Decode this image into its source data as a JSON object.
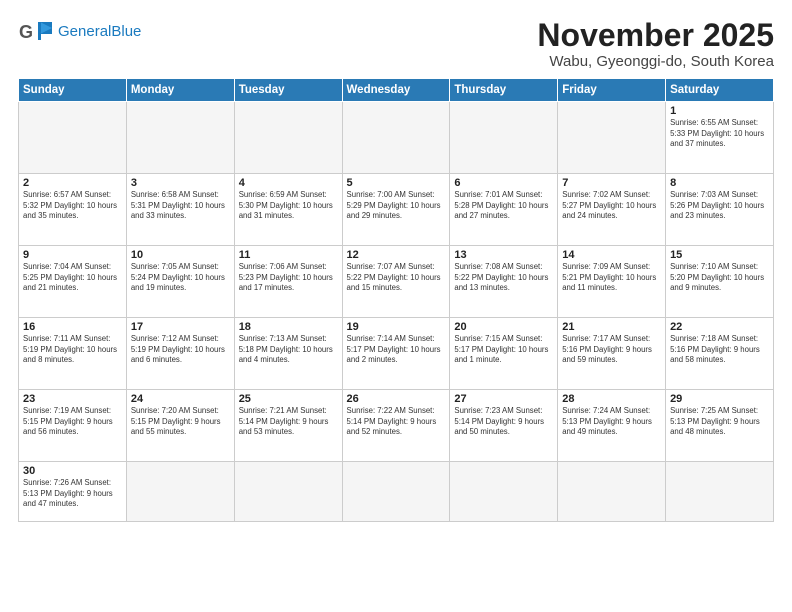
{
  "header": {
    "logo_general": "General",
    "logo_blue": "Blue",
    "month_title": "November 2025",
    "location": "Wabu, Gyeonggi-do, South Korea"
  },
  "days_of_week": [
    "Sunday",
    "Monday",
    "Tuesday",
    "Wednesday",
    "Thursday",
    "Friday",
    "Saturday"
  ],
  "weeks": [
    [
      {
        "day": "",
        "info": ""
      },
      {
        "day": "",
        "info": ""
      },
      {
        "day": "",
        "info": ""
      },
      {
        "day": "",
        "info": ""
      },
      {
        "day": "",
        "info": ""
      },
      {
        "day": "",
        "info": ""
      },
      {
        "day": "1",
        "info": "Sunrise: 6:55 AM\nSunset: 5:33 PM\nDaylight: 10 hours\nand 37 minutes."
      }
    ],
    [
      {
        "day": "2",
        "info": "Sunrise: 6:57 AM\nSunset: 5:32 PM\nDaylight: 10 hours\nand 35 minutes."
      },
      {
        "day": "3",
        "info": "Sunrise: 6:58 AM\nSunset: 5:31 PM\nDaylight: 10 hours\nand 33 minutes."
      },
      {
        "day": "4",
        "info": "Sunrise: 6:59 AM\nSunset: 5:30 PM\nDaylight: 10 hours\nand 31 minutes."
      },
      {
        "day": "5",
        "info": "Sunrise: 7:00 AM\nSunset: 5:29 PM\nDaylight: 10 hours\nand 29 minutes."
      },
      {
        "day": "6",
        "info": "Sunrise: 7:01 AM\nSunset: 5:28 PM\nDaylight: 10 hours\nand 27 minutes."
      },
      {
        "day": "7",
        "info": "Sunrise: 7:02 AM\nSunset: 5:27 PM\nDaylight: 10 hours\nand 24 minutes."
      },
      {
        "day": "8",
        "info": "Sunrise: 7:03 AM\nSunset: 5:26 PM\nDaylight: 10 hours\nand 23 minutes."
      }
    ],
    [
      {
        "day": "9",
        "info": "Sunrise: 7:04 AM\nSunset: 5:25 PM\nDaylight: 10 hours\nand 21 minutes."
      },
      {
        "day": "10",
        "info": "Sunrise: 7:05 AM\nSunset: 5:24 PM\nDaylight: 10 hours\nand 19 minutes."
      },
      {
        "day": "11",
        "info": "Sunrise: 7:06 AM\nSunset: 5:23 PM\nDaylight: 10 hours\nand 17 minutes."
      },
      {
        "day": "12",
        "info": "Sunrise: 7:07 AM\nSunset: 5:22 PM\nDaylight: 10 hours\nand 15 minutes."
      },
      {
        "day": "13",
        "info": "Sunrise: 7:08 AM\nSunset: 5:22 PM\nDaylight: 10 hours\nand 13 minutes."
      },
      {
        "day": "14",
        "info": "Sunrise: 7:09 AM\nSunset: 5:21 PM\nDaylight: 10 hours\nand 11 minutes."
      },
      {
        "day": "15",
        "info": "Sunrise: 7:10 AM\nSunset: 5:20 PM\nDaylight: 10 hours\nand 9 minutes."
      }
    ],
    [
      {
        "day": "16",
        "info": "Sunrise: 7:11 AM\nSunset: 5:19 PM\nDaylight: 10 hours\nand 8 minutes."
      },
      {
        "day": "17",
        "info": "Sunrise: 7:12 AM\nSunset: 5:19 PM\nDaylight: 10 hours\nand 6 minutes."
      },
      {
        "day": "18",
        "info": "Sunrise: 7:13 AM\nSunset: 5:18 PM\nDaylight: 10 hours\nand 4 minutes."
      },
      {
        "day": "19",
        "info": "Sunrise: 7:14 AM\nSunset: 5:17 PM\nDaylight: 10 hours\nand 2 minutes."
      },
      {
        "day": "20",
        "info": "Sunrise: 7:15 AM\nSunset: 5:17 PM\nDaylight: 10 hours\nand 1 minute."
      },
      {
        "day": "21",
        "info": "Sunrise: 7:17 AM\nSunset: 5:16 PM\nDaylight: 9 hours\nand 59 minutes."
      },
      {
        "day": "22",
        "info": "Sunrise: 7:18 AM\nSunset: 5:16 PM\nDaylight: 9 hours\nand 58 minutes."
      }
    ],
    [
      {
        "day": "23",
        "info": "Sunrise: 7:19 AM\nSunset: 5:15 PM\nDaylight: 9 hours\nand 56 minutes."
      },
      {
        "day": "24",
        "info": "Sunrise: 7:20 AM\nSunset: 5:15 PM\nDaylight: 9 hours\nand 55 minutes."
      },
      {
        "day": "25",
        "info": "Sunrise: 7:21 AM\nSunset: 5:14 PM\nDaylight: 9 hours\nand 53 minutes."
      },
      {
        "day": "26",
        "info": "Sunrise: 7:22 AM\nSunset: 5:14 PM\nDaylight: 9 hours\nand 52 minutes."
      },
      {
        "day": "27",
        "info": "Sunrise: 7:23 AM\nSunset: 5:14 PM\nDaylight: 9 hours\nand 50 minutes."
      },
      {
        "day": "28",
        "info": "Sunrise: 7:24 AM\nSunset: 5:13 PM\nDaylight: 9 hours\nand 49 minutes."
      },
      {
        "day": "29",
        "info": "Sunrise: 7:25 AM\nSunset: 5:13 PM\nDaylight: 9 hours\nand 48 minutes."
      }
    ],
    [
      {
        "day": "30",
        "info": "Sunrise: 7:26 AM\nSunset: 5:13 PM\nDaylight: 9 hours\nand 47 minutes."
      },
      {
        "day": "",
        "info": ""
      },
      {
        "day": "",
        "info": ""
      },
      {
        "day": "",
        "info": ""
      },
      {
        "day": "",
        "info": ""
      },
      {
        "day": "",
        "info": ""
      },
      {
        "day": "",
        "info": ""
      }
    ]
  ]
}
